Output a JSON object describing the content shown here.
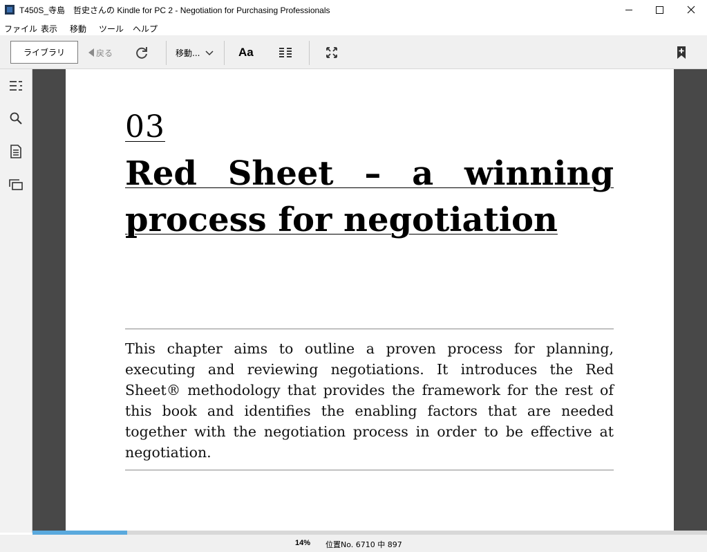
{
  "window": {
    "title": "T450S_寺島　哲史さんの Kindle for PC 2 - Negotiation for Purchasing Professionals"
  },
  "menu": [
    "ファイル",
    "表示",
    "移動",
    "ツール",
    "ヘルプ"
  ],
  "toolbar": {
    "library_label": "ライブラリ",
    "back_label": "戻る",
    "goto_label": "移動...",
    "font_label": "Aa"
  },
  "icons": {
    "sync": "sync-icon",
    "goto_chevron": "chevron-down-icon",
    "columns": "columns-icon",
    "fullscreen": "fullscreen-icon",
    "add_bookmark": "add-bookmark-icon",
    "toc": "table-of-contents-icon",
    "search": "search-icon",
    "notes": "notes-icon",
    "flashcards": "flashcards-icon"
  },
  "page": {
    "chapter_number": "03",
    "chapter_title": "Red Sheet – a winning process for negotiation",
    "abstract": "This chapter aims to outline a proven process for planning, executing and reviewing negotiations. It introduces the Red Sheet® methodology that provides the framework for the rest of this book and identifies the enabling factors that are needed together with the negotiation process in order to be effective at negotiation."
  },
  "status": {
    "percent_label": "14%",
    "location_label": "位置No. 6710 中 897",
    "progress_fraction": 0.14
  },
  "colors": {
    "reader_background": "#484848",
    "progress": "#5aa9dd"
  }
}
